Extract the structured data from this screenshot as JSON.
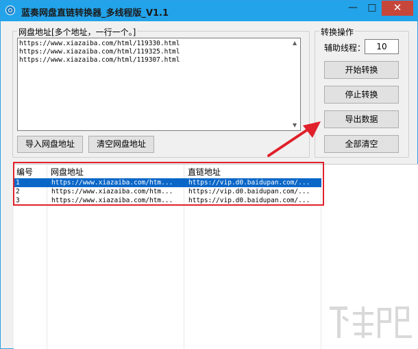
{
  "window": {
    "title": "蓝奏网盘直链转换器_多线程版_V1.1",
    "minimize": "—",
    "maximize": "□",
    "close": "✕"
  },
  "url_group": {
    "label": "网盘地址[多个地址，一行一个。]",
    "textarea_value": "https://www.xiazaiba.com/html/119330.html\nhttps://www.xiazaiba.com/html/119325.html\nhttps://www.xiazaiba.com/html/119307.html",
    "import_button": "导入网盘地址",
    "clear_button": "清空网盘地址"
  },
  "ops_group": {
    "label": "转换操作",
    "thread_label": "辅助线程：",
    "thread_value": "10",
    "start_button": "开始转换",
    "stop_button": "停止转换",
    "export_button": "导出数据",
    "clear_all_button": "全部清空"
  },
  "table": {
    "headers": [
      "编号",
      "网盘地址",
      "直链地址"
    ],
    "rows": [
      {
        "id": "1",
        "url": "https://www.xiazaiba.com/htm...",
        "direct": "https://vip.d0.baidupan.com/..."
      },
      {
        "id": "2",
        "url": "https://www.xiazaiba.com/htm...",
        "direct": "https://vip.d0.baidupan.com/..."
      },
      {
        "id": "3",
        "url": "https://www.xiazaiba.com/htm...",
        "direct": "https://vip.d0.baidupan.com/..."
      }
    ],
    "selected_row": 0
  },
  "colors": {
    "title_bar": "#23a3ea",
    "close_button": "#c7463a",
    "annotation_red": "#e0202a",
    "selection": "#0a67c8"
  },
  "watermark": {
    "icon": "xiazaiba-logo"
  }
}
